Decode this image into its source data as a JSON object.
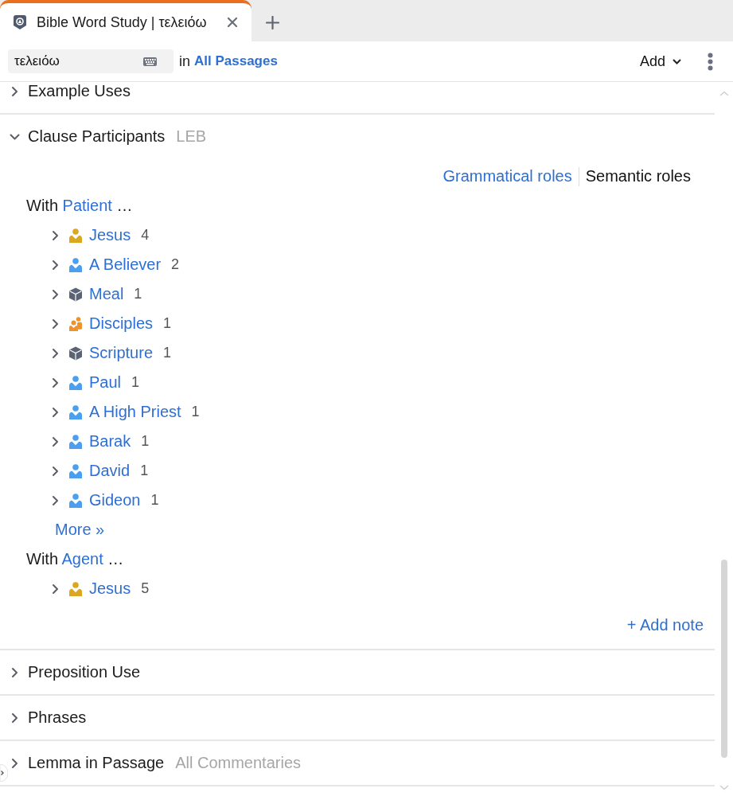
{
  "tab_bar": {
    "tabs": [
      {
        "title": "Bible Word Study | τελειόω",
        "selected": true
      }
    ]
  },
  "toolbar": {
    "search": {
      "value": "τελειόω"
    },
    "scope_prefix": "in",
    "scope_link": "All Passages",
    "add_button": "Add"
  },
  "sections": [
    {
      "title": "Example Uses",
      "expanded": false
    },
    {
      "title": "Clause Participants",
      "subtitle": "LEB",
      "expanded": true,
      "role_tabs": [
        {
          "label": "Grammatical roles",
          "selected": false
        },
        {
          "label": "Semantic roles",
          "selected": true
        }
      ],
      "groups": [
        {
          "prefix": "With",
          "role": "Patient",
          "suffix": "…",
          "items": [
            {
              "name": "Jesus",
              "count": "4",
              "kind": "person",
              "color": "#dba723",
              "expanded": false
            },
            {
              "name": "A Believer",
              "count": "2",
              "kind": "person",
              "color": "#4b9ff0",
              "expanded": false
            },
            {
              "name": "Meal",
              "count": "1",
              "kind": "thing",
              "color": "#5b6374",
              "expanded": false
            },
            {
              "name": "Disciples",
              "count": "1",
              "kind": "group",
              "color": "#f0922b",
              "expanded": false
            },
            {
              "name": "Scripture",
              "count": "1",
              "kind": "thing",
              "color": "#5b6374",
              "expanded": false
            },
            {
              "name": "Paul",
              "count": "1",
              "kind": "person",
              "color": "#4b9ff0",
              "expanded": false
            },
            {
              "name": "A High Priest",
              "count": "1",
              "kind": "person",
              "color": "#4b9ff0",
              "expanded": false
            },
            {
              "name": "Barak",
              "count": "1",
              "kind": "person",
              "color": "#4b9ff0",
              "expanded": false
            },
            {
              "name": "David",
              "count": "1",
              "kind": "person",
              "color": "#4b9ff0",
              "expanded": false
            },
            {
              "name": "Gideon",
              "count": "1",
              "kind": "person",
              "color": "#4b9ff0",
              "expanded": false
            }
          ],
          "more": "More »"
        },
        {
          "prefix": "With",
          "role": "Agent",
          "suffix": "…",
          "items": [
            {
              "name": "Jesus",
              "count": "5",
              "kind": "person",
              "color": "#dba723",
              "expanded": false
            }
          ]
        }
      ],
      "add_note": "+ Add note"
    },
    {
      "title": "Preposition Use",
      "expanded": false
    },
    {
      "title": "Phrases",
      "expanded": false
    },
    {
      "title": "Lemma in Passage",
      "subtitle": "All Commentaries",
      "expanded": false
    }
  ]
}
